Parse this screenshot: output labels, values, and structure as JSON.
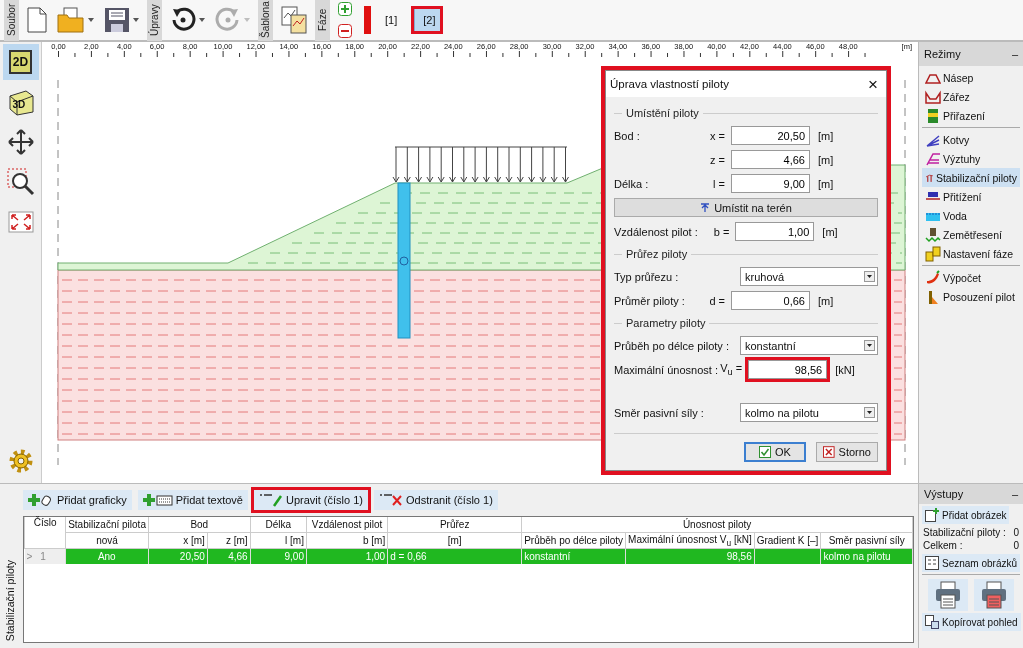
{
  "toolbar": {
    "groups": [
      {
        "label": "Soubor"
      },
      {
        "label": "Úpravy"
      },
      {
        "label": "Šablona"
      },
      {
        "label": "Fáze"
      }
    ],
    "undo": {
      "disabled": false
    },
    "redo": {
      "disabled": true
    },
    "phases": [
      {
        "label": "[1]",
        "selected": false,
        "highlighted": false
      },
      {
        "label": "[2]",
        "selected": true,
        "highlighted": true
      }
    ]
  },
  "view_tools": [
    {
      "kind": "flat",
      "label": "2D",
      "selected": true
    },
    {
      "kind": "cube",
      "label": "3D",
      "selected": false
    },
    {
      "kind": "move",
      "selected": false
    },
    {
      "kind": "zoom",
      "selected": false
    },
    {
      "kind": "fit",
      "selected": false
    }
  ],
  "ruler": {
    "labels": [
      "0,00",
      "2,00",
      "4,00",
      "6,00",
      "8,00",
      "10,00",
      "12,00",
      "14,00",
      "16,00",
      "18,00",
      "20,00",
      "22,00",
      "24,00",
      "26,00",
      "28,00",
      "30,00",
      "32,00",
      "34,00",
      "36,00",
      "38,00",
      "40,00",
      "42,00",
      "44,00",
      "46,00",
      "48,00"
    ],
    "unit": "[m]"
  },
  "dialog": {
    "title": "Úprava vlastností piloty",
    "close": "×",
    "highlighted": true,
    "sections": [
      {
        "title": "Umístění piloty",
        "rows": [
          {
            "kind": "field",
            "label": "Bod :",
            "var": "x =",
            "value": "20,50",
            "unit": "[m]",
            "highlighted": false
          },
          {
            "kind": "field",
            "var": "z =",
            "value": "4,66",
            "unit": "[m]",
            "highlighted": false
          },
          {
            "kind": "field",
            "label": "Délka :",
            "var": "l =",
            "value": "9,00",
            "unit": "[m]",
            "highlighted": false
          },
          {
            "kind": "button",
            "label": "Umístit na terén"
          },
          {
            "kind": "field",
            "label": "Vzdálenost pilot :",
            "var": "b =",
            "value": "1,00",
            "unit": "[m]",
            "highlighted": false
          }
        ]
      },
      {
        "title": "Průřez piloty",
        "rows": [
          {
            "kind": "select",
            "label": "Typ průřezu :",
            "value": "kruhová"
          },
          {
            "kind": "field",
            "label": "Průměr piloty :",
            "var": "d =",
            "value": "0,66",
            "unit": "[m]",
            "highlighted": false
          }
        ]
      },
      {
        "title": "Parametry piloty",
        "rows": [
          {
            "kind": "select",
            "label": "Průběh po délce piloty :",
            "value": "konstantní"
          },
          {
            "kind": "field",
            "label": "Maximální únosnost :",
            "var": "V$_{u}$ =",
            "value": "98,56",
            "unit": "[kN]",
            "highlighted": true
          }
        ]
      },
      {
        "rows": [
          {
            "kind": "select",
            "label": "Směr pasivní síly :",
            "value": "kolmo na pilotu"
          }
        ]
      }
    ],
    "buttons": [
      {
        "kind": "ok",
        "label": "OK",
        "default": true
      },
      {
        "kind": "cancel",
        "label": "Storno",
        "default": false
      }
    ]
  },
  "modes": {
    "title": "Režimy",
    "collapse": "–",
    "groups": [
      {
        "items": [
          {
            "kind": "embankment",
            "label": "Násep",
            "selected": false
          },
          {
            "kind": "cut",
            "label": "Zářez",
            "selected": false
          },
          {
            "kind": "assign",
            "label": "Přiřazení",
            "selected": false
          }
        ]
      },
      {
        "items": [
          {
            "kind": "anchors",
            "label": "Kotvy",
            "selected": false
          },
          {
            "kind": "reinforcement",
            "label": "Výztuhy",
            "selected": false
          },
          {
            "kind": "piles",
            "label": "Stabilizační piloty",
            "selected": true
          },
          {
            "kind": "surcharge",
            "label": "Přitížení",
            "selected": false
          },
          {
            "kind": "water",
            "label": "Voda",
            "selected": false
          },
          {
            "kind": "earthquake",
            "label": "Zemětřesení",
            "selected": false
          },
          {
            "kind": "stage",
            "label": "Nastavení fáze",
            "selected": false
          }
        ]
      },
      {
        "items": [
          {
            "kind": "analysis",
            "label": "Výpočet",
            "selected": false
          },
          {
            "kind": "pile-check",
            "label": "Posouzení pilot",
            "selected": false
          }
        ]
      }
    ]
  },
  "bottom_panel": {
    "tab": "Stabilizační piloty",
    "actions": [
      {
        "kind": "add-graphic",
        "label": "Přidat graficky",
        "highlighted": false
      },
      {
        "kind": "add-text",
        "label": "Přidat textově",
        "highlighted": false
      },
      {
        "kind": "edit",
        "label": "Upravit (číslo 1)",
        "highlighted": true
      },
      {
        "kind": "remove",
        "label": "Odstranit (číslo 1)",
        "highlighted": false
      }
    ],
    "table": {
      "header_groups": [
        {
          "label": "Číslo"
        },
        {
          "label": "Stabilizační pilota",
          "columns": [
            "nová"
          ]
        },
        {
          "label": "Bod",
          "columns": [
            "x [m]",
            "z [m]"
          ]
        },
        {
          "label": "Délka",
          "columns": [
            "l [m]"
          ]
        },
        {
          "label": "Vzdálenost pilot",
          "columns": [
            "b [m]"
          ]
        },
        {
          "label": "Průřez",
          "columns": [
            "[m]"
          ]
        },
        {
          "label": "Únosnost piloty",
          "columns": [
            "Průběh po délce piloty",
            "Maximální únosnost V$_{u}$ [kN]",
            "Gradient K [–]",
            "Směr pasivní síly"
          ]
        }
      ],
      "rows": [
        {
          "marker": ">",
          "number": "1",
          "selected": true,
          "cells": [
            "Ano",
            "20,50",
            "4,66",
            "9,00",
            "1,00",
            "d = 0,66",
            "konstantní",
            "98,56",
            null,
            "kolmo na pilotu"
          ]
        }
      ]
    }
  },
  "outputs": {
    "title": "Výstupy",
    "collapse": "–",
    "add_button": "Přidat obrázek",
    "counts": [
      {
        "label": "Stabilizační piloty :",
        "value": "0"
      },
      {
        "label": "Celkem :",
        "value": "0"
      }
    ],
    "list_button": "Seznam obrázků",
    "copy_button": "Kopírovat pohled"
  }
}
